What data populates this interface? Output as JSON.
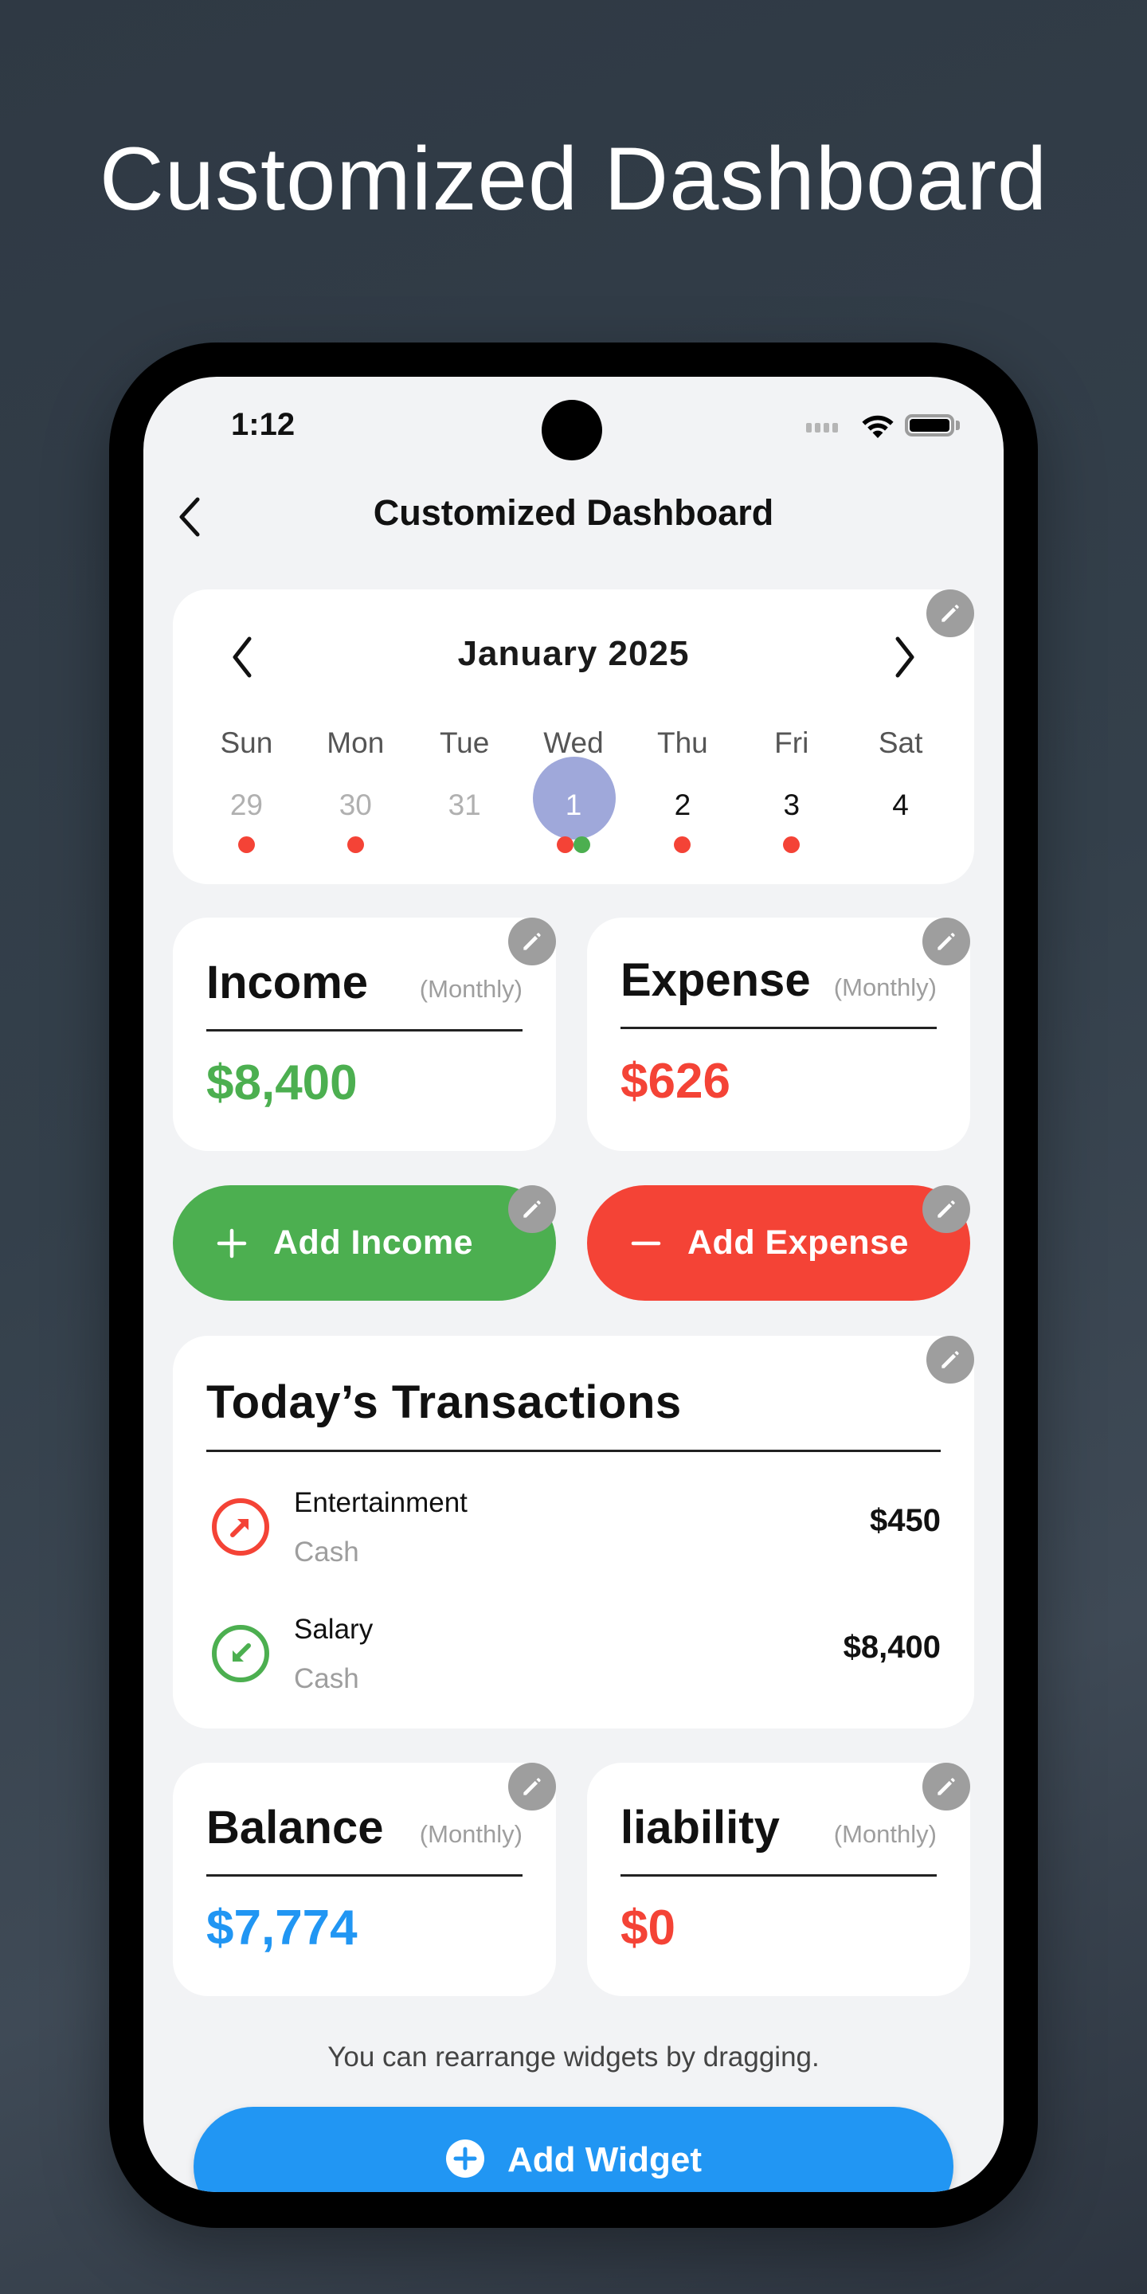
{
  "hero": {
    "title": "Customized Dashboard"
  },
  "status_bar": {
    "time": "1:12"
  },
  "nav": {
    "title": "Customized Dashboard",
    "back_icon": "chevron-left-icon"
  },
  "colors": {
    "income": "#4caf50",
    "expense": "#f44336",
    "balance": "#2196f3",
    "liability": "#f44336",
    "selected_day": "#9fa8da",
    "edit_button": "#9e9e9e"
  },
  "calendar": {
    "month_label": "January 2025",
    "weekdays": [
      "Sun",
      "Mon",
      "Tue",
      "Wed",
      "Thu",
      "Fri",
      "Sat"
    ],
    "days": [
      {
        "label": "29",
        "muted": true,
        "selected": false,
        "dots": [
          "expense"
        ]
      },
      {
        "label": "30",
        "muted": true,
        "selected": false,
        "dots": [
          "expense"
        ]
      },
      {
        "label": "31",
        "muted": true,
        "selected": false,
        "dots": []
      },
      {
        "label": "1",
        "muted": false,
        "selected": true,
        "dots": [
          "expense",
          "income"
        ]
      },
      {
        "label": "2",
        "muted": false,
        "selected": false,
        "dots": [
          "expense"
        ]
      },
      {
        "label": "3",
        "muted": false,
        "selected": false,
        "dots": [
          "expense"
        ]
      },
      {
        "label": "4",
        "muted": false,
        "selected": false,
        "dots": []
      }
    ]
  },
  "widgets": {
    "income": {
      "title": "Income",
      "period": "(Monthly)",
      "value": "$8,400"
    },
    "expense": {
      "title": "Expense",
      "period": "(Monthly)",
      "value": "$626"
    },
    "balance": {
      "title": "Balance",
      "period": "(Monthly)",
      "value": "$7,774"
    },
    "liability": {
      "title": "liability",
      "period": "(Monthly)",
      "value": "$0"
    }
  },
  "actions": {
    "add_income": "Add Income",
    "add_expense": "Add Expense"
  },
  "transactions": {
    "title": "Today’s Transactions",
    "items": [
      {
        "category": "Entertainment",
        "account": "Cash",
        "amount": "$450",
        "type": "expense",
        "icon": "arrow-up-right-circle-icon"
      },
      {
        "category": "Salary",
        "account": "Cash",
        "amount": "$8,400",
        "type": "income",
        "icon": "arrow-down-left-circle-icon"
      }
    ]
  },
  "footer": {
    "hint": "You can rearrange widgets by dragging.",
    "add_widget": "Add Widget"
  }
}
